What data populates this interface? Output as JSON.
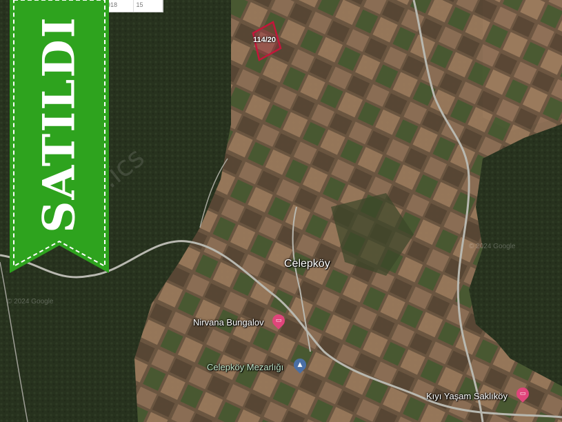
{
  "map": {
    "village": "Celepköy",
    "pois": {
      "nirvana": "Nirvana Bungalov",
      "mezarlik": "Celepköy Mezarlığı",
      "kiyi": "Kıyı Yaşam Saklıköy"
    },
    "parcel_label": "114/20",
    "watermark": "www.ics",
    "copyright_left": "© 2024 Google",
    "copyright_right": "© 2024 Google"
  },
  "table": {
    "cells": [
      "918",
      "15"
    ]
  },
  "banner": {
    "text": "SATILDI",
    "color": "#2ea31e"
  },
  "colors": {
    "forest": "#28331f",
    "field_light": "#8f7057",
    "field_dark": "#5d4a38",
    "road": "#b8b8b0",
    "parcel_outline": "#c4163a",
    "poi_pink": "#e0457b",
    "poi_blue": "#4a6fa5"
  },
  "icons": [
    "hotel-marker-icon",
    "cemetery-marker-icon"
  ]
}
